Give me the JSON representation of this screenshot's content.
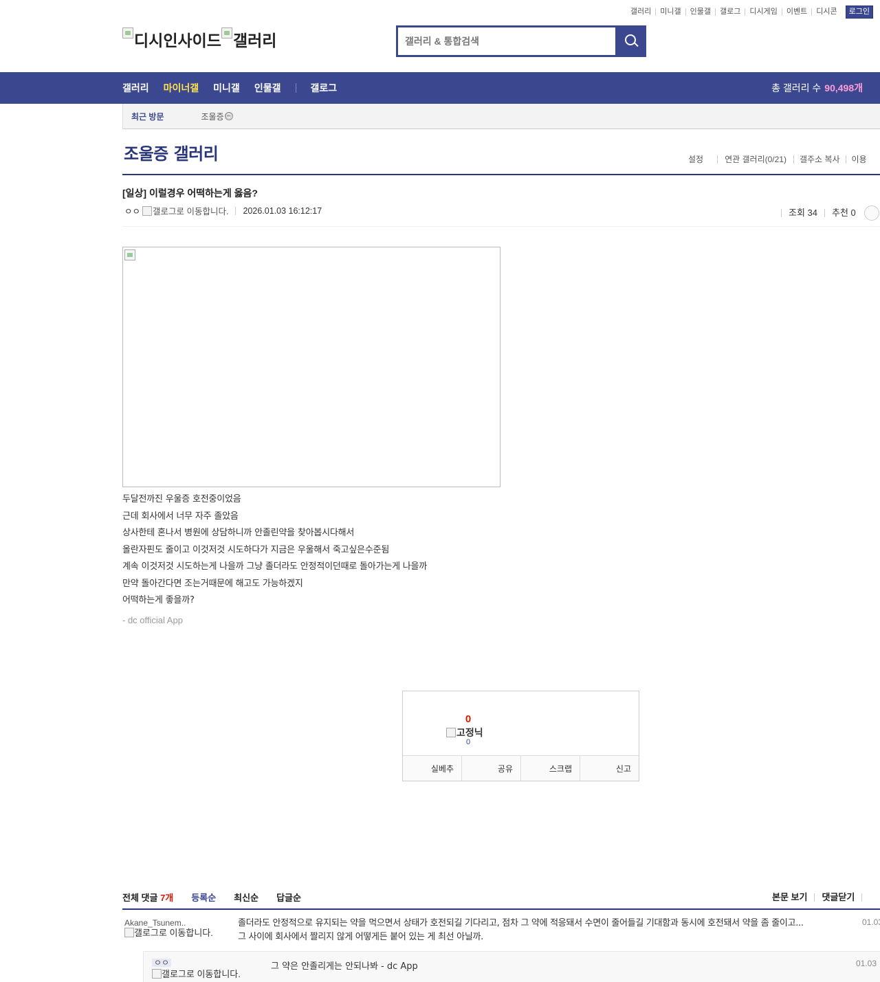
{
  "util_menu": [
    "갤러리",
    "미니갤",
    "인물갤",
    "갤로그",
    "디시게임",
    "이벤트",
    "디시콘"
  ],
  "login_label": "로그인",
  "logo": {
    "alt1": "디시인사이드",
    "alt2": "갤러리"
  },
  "search": {
    "placeholder": "갤러리 & 통합검색"
  },
  "nav": {
    "items": [
      "갤러리",
      "마이너갤",
      "미니갤",
      "인물갤"
    ],
    "gallog": "갤로그",
    "total_label": "총 갤러리 수",
    "total_count": "90,498개"
  },
  "recent": {
    "label": "최근 방문",
    "gallery": "조울증",
    "badge": "ⓜ"
  },
  "gallery": {
    "title": "조울증 갤러리",
    "tools": [
      "설정",
      "연관 갤러리(0/21)",
      "갤주소 복사",
      "이용"
    ]
  },
  "post": {
    "title": "[일상] 이럴경우 어떡하는게 옳음?",
    "writer": "ㅇㅇ",
    "writer_icon_alt": "갤로그로 이동합니다.",
    "date": "2026.01.03 16:12:17",
    "views": "조회 34",
    "recommend": "추천 0",
    "lines": [
      "두달전까진 우울증 호전중이었음",
      "근데 회사에서 너무 자주 졸았음",
      "상사한테 혼나서 병원에 상담하니까 안졸린약을 찾아봅시다해서",
      "올란자핀도 줄이고 이것저것 시도하다가 지금은 우울해서 죽고싶은수준됨",
      "계속 이것저것 시도하는게 나을까 그냥 졸더라도 안정적이던때로 돌아가는게 나을까",
      "만약 돌아간다면 조는거때문에 해고도 가능하겠지",
      "어떡하는게 좋을까?"
    ],
    "app_signature": "- dc official App"
  },
  "recommend_box": {
    "count": "0",
    "fixed_nick_alt": "고정닉",
    "fixed_count": "0",
    "buttons": [
      "실베추",
      "공유",
      "스크랩",
      "신고"
    ]
  },
  "comments": {
    "total_label": "전체 댓글",
    "total_count": "7개",
    "sorts": [
      "등록순",
      "최신순",
      "답글순"
    ],
    "right": [
      "본문 보기",
      "댓글닫기"
    ],
    "items": [
      {
        "nick": "Akane_Tsunem..",
        "icon_alt": "갤로그로 이동합니다.",
        "text": "졸더라도 안정적으로 유지되는 약을 먹으면서 상태가 호전되길 기다리고, 점차 그 약에 적응돼서 수면이 줄어들길 기대함과 동시에 호전돼서 약을 좀 줄이고... 그 사이에 회사에서 짤리지 않게 어떻게든 붙어 있는 게 최선 아닐까.",
        "date": "01.03"
      },
      {
        "nick": "ㅇㅇ",
        "icon_alt": "갤로그로 이동합니다.",
        "text": "그 약은 안졸리게는 안되나봐 - dc App",
        "date": "01.03"
      }
    ]
  }
}
